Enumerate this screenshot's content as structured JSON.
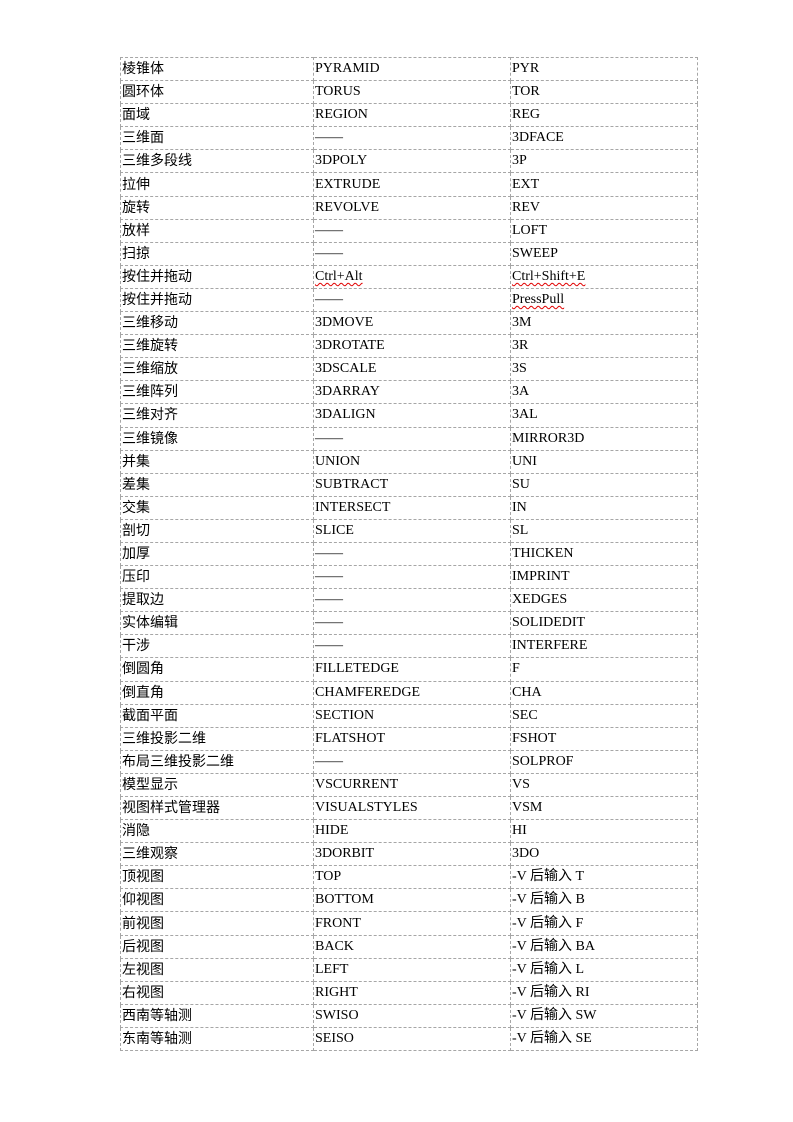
{
  "table": {
    "rows": [
      {
        "name": "棱锥体",
        "command": "PYRAMID",
        "alias": "PYR"
      },
      {
        "name": "圆环体",
        "command": "TORUS",
        "alias": "TOR"
      },
      {
        "name": "面域",
        "command": "REGION",
        "alias": "REG"
      },
      {
        "name": "三维面",
        "command": "——",
        "alias": "3DFACE"
      },
      {
        "name": "三维多段线",
        "command": "3DPOLY",
        "alias": "3P"
      },
      {
        "name": "拉伸",
        "command": "EXTRUDE",
        "alias": "EXT"
      },
      {
        "name": "旋转",
        "command": "REVOLVE",
        "alias": "REV"
      },
      {
        "name": "放样",
        "command": "——",
        "alias": "LOFT"
      },
      {
        "name": "扫掠",
        "command": "——",
        "alias": "SWEEP"
      },
      {
        "name": "按住并拖动",
        "command": "Ctrl+Alt",
        "alias": "Ctrl+Shift+E",
        "spell_command": true,
        "spell_alias": true
      },
      {
        "name": "按住并拖动",
        "command": "——",
        "alias": "PressPull",
        "spell_alias": true
      },
      {
        "name": "三维移动",
        "command": "3DMOVE",
        "alias": "3M"
      },
      {
        "name": "三维旋转",
        "command": "3DROTATE",
        "alias": "3R"
      },
      {
        "name": "三维缩放",
        "command": "3DSCALE",
        "alias": "3S"
      },
      {
        "name": "三维阵列",
        "command": "3DARRAY",
        "alias": "3A"
      },
      {
        "name": "三维对齐",
        "command": "3DALIGN",
        "alias": "3AL"
      },
      {
        "name": "三维镜像",
        "command": "——",
        "alias": "MIRROR3D"
      },
      {
        "name": "并集",
        "command": "UNION",
        "alias": "UNI"
      },
      {
        "name": "差集",
        "command": "SUBTRACT",
        "alias": "SU"
      },
      {
        "name": "交集",
        "command": "INTERSECT",
        "alias": "IN"
      },
      {
        "name": "剖切",
        "command": "SLICE",
        "alias": "SL"
      },
      {
        "name": "加厚",
        "command": "——",
        "alias": "THICKEN"
      },
      {
        "name": "压印",
        "command": "——",
        "alias": "IMPRINT"
      },
      {
        "name": "提取边",
        "command": "——",
        "alias": "XEDGES"
      },
      {
        "name": "实体编辑",
        "command": "——",
        "alias": "SOLIDEDIT"
      },
      {
        "name": "干涉",
        "command": "——",
        "alias": "INTERFERE"
      },
      {
        "name": "倒圆角",
        "command": "FILLETEDGE",
        "alias": "F"
      },
      {
        "name": "倒直角",
        "command": "CHAMFEREDGE",
        "alias": "CHA"
      },
      {
        "name": "截面平面",
        "command": "SECTION",
        "alias": "SEC"
      },
      {
        "name": "三维投影二维",
        "command": "FLATSHOT",
        "alias": "FSHOT"
      },
      {
        "name": "布局三维投影二维",
        "command": "——",
        "alias": "SOLPROF"
      },
      {
        "name": "模型显示",
        "command": "VSCURRENT",
        "alias": "VS"
      },
      {
        "name": "视图样式管理器",
        "command": "VISUALSTYLES",
        "alias": "VSM"
      },
      {
        "name": "消隐",
        "command": "HIDE",
        "alias": "HI"
      },
      {
        "name": "三维观察",
        "command": "3DORBIT",
        "alias": "3DO"
      },
      {
        "name": "顶视图",
        "command": "TOP",
        "alias": "-V 后输入 T"
      },
      {
        "name": "仰视图",
        "command": "BOTTOM",
        "alias": "-V 后输入 B"
      },
      {
        "name": "前视图",
        "command": "FRONT",
        "alias": "-V 后输入 F"
      },
      {
        "name": "后视图",
        "command": "BACK",
        "alias": "-V 后输入 BA"
      },
      {
        "name": "左视图",
        "command": "LEFT",
        "alias": "-V 后输入 L"
      },
      {
        "name": "右视图",
        "command": "RIGHT",
        "alias": "-V 后输入 RI"
      },
      {
        "name": "西南等轴测",
        "command": "SWISO",
        "alias": "-V 后输入 SW"
      },
      {
        "name": "东南等轴测",
        "command": "SEISO",
        "alias": "-V 后输入 SE"
      }
    ]
  },
  "colors": {
    "border": "#a6a6a6",
    "spellcheck_underline": "#e00000",
    "text": "#000000"
  }
}
